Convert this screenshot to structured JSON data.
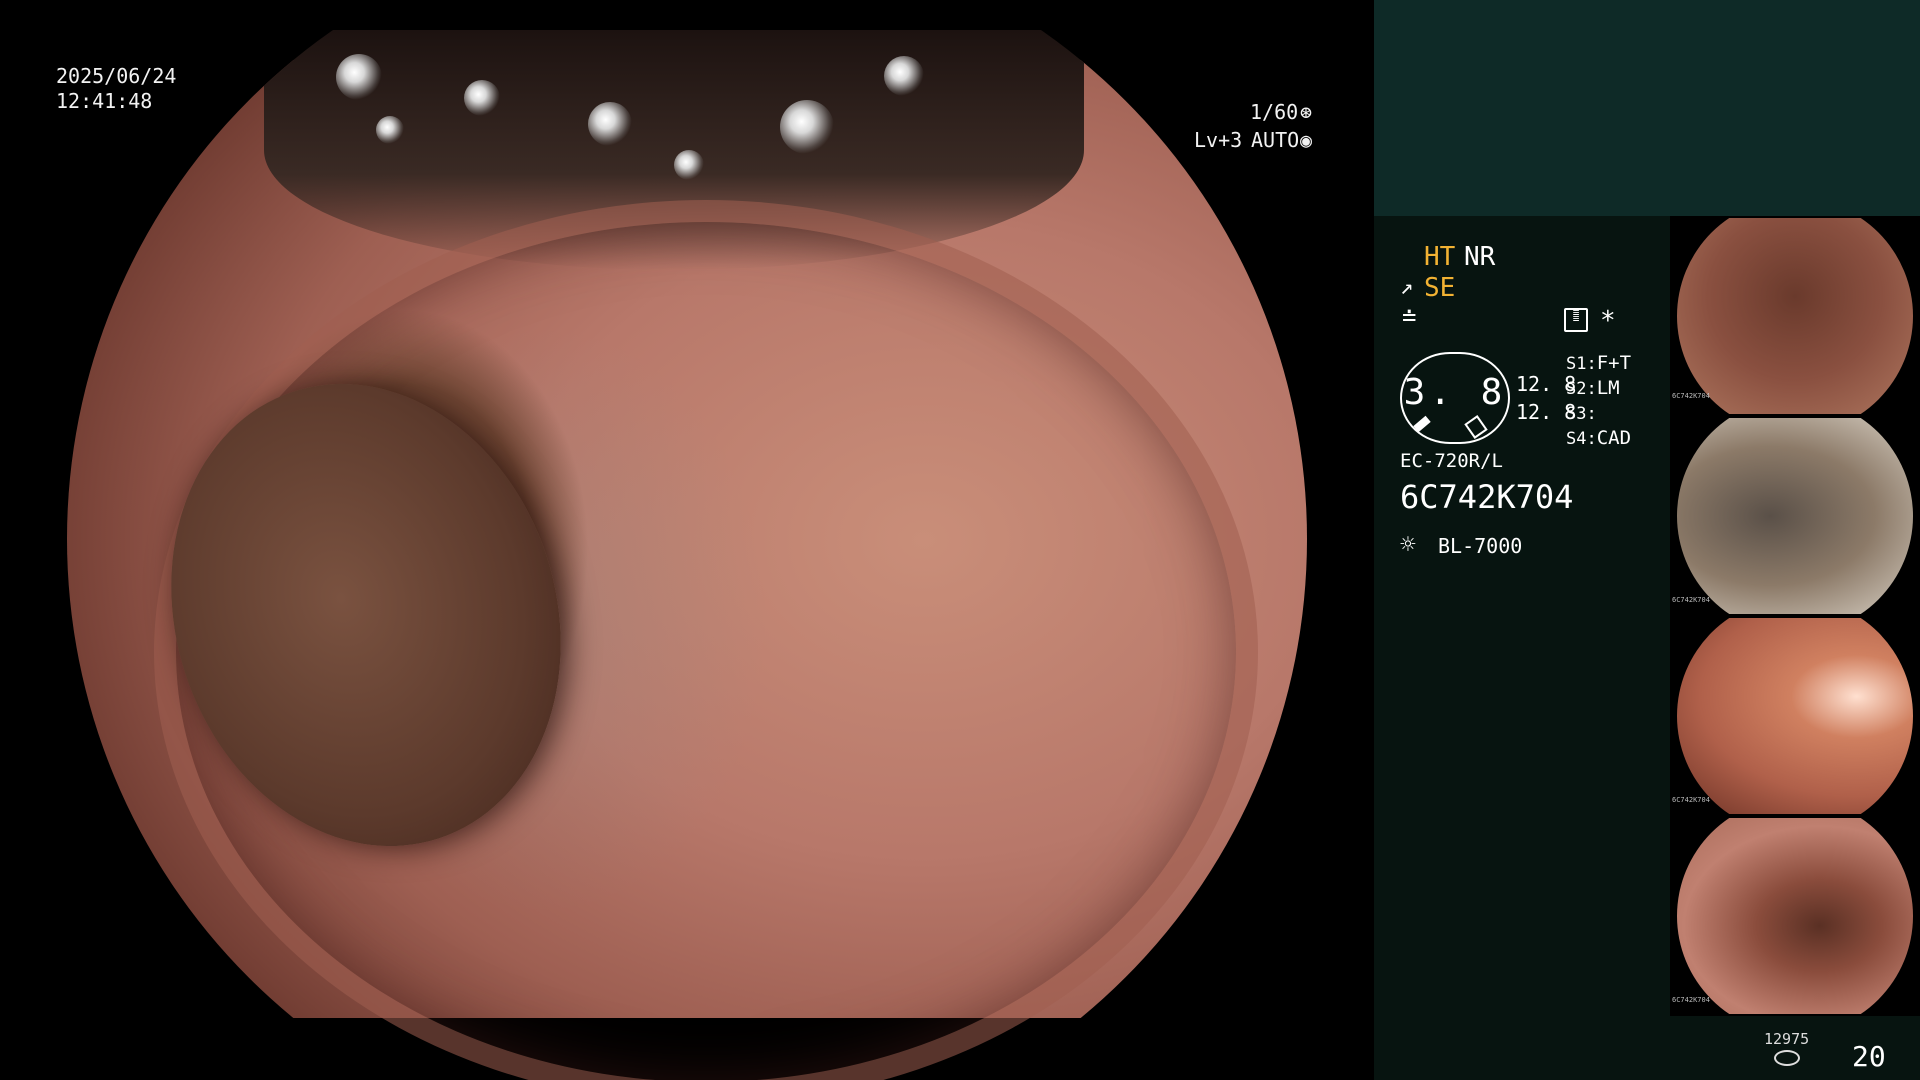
{
  "overlay": {
    "date": "2025/06/24",
    "time": "12:41:48",
    "shutter": "1/60",
    "shutter_icon": "shutter-icon",
    "level": "Lv+3",
    "mode": "AUTO",
    "mode_icon": "auto-iris-icon"
  },
  "panel": {
    "ht": "HT",
    "nr": "NR",
    "se": "SE",
    "se_icon": "structure-enhancement-icon",
    "color_icon": "color-mode-icon",
    "menu_icon": "settings-list-icon",
    "asterisk": "*",
    "iris_value": "3. 8",
    "value_a": "12. 8",
    "value_b": "12. 8",
    "scope_buttons": [
      {
        "key": "S1:",
        "value": "F+T"
      },
      {
        "key": "S2:",
        "value": "LM"
      },
      {
        "key": "S3:",
        "value": ""
      },
      {
        "key": "S4:",
        "value": "CAD"
      }
    ],
    "scope_model": "EC-720R/L",
    "serial": "6C742K704",
    "light_icon": "light-source-icon",
    "light_source": "BL-7000",
    "capture_count": "12975",
    "storage_icon": "storage-disk-icon",
    "page_number": "20"
  },
  "thumbnails": [
    {
      "label": "6C742K704",
      "tone": "#8a5040"
    },
    {
      "label": "6C742K704",
      "tone": "#8c7a68"
    },
    {
      "label": "6C742K704",
      "tone": "#b0604a"
    },
    {
      "label": "6C742K704",
      "tone": "#a86a58"
    }
  ],
  "colors": {
    "panel_top": "#0e2a27",
    "panel": "#071410",
    "highlight": "#f2b233"
  }
}
